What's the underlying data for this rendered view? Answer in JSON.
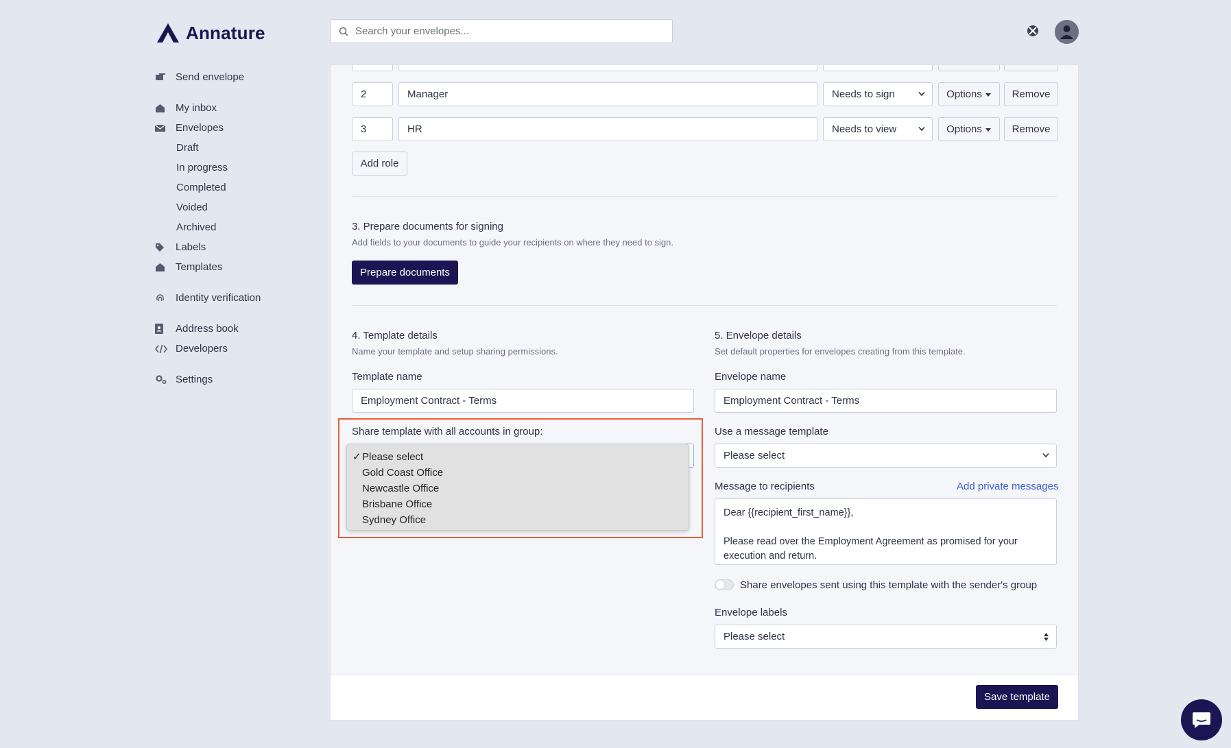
{
  "app": {
    "name": "Annature"
  },
  "search": {
    "placeholder": "Search your envelopes..."
  },
  "sidebar": {
    "send": "Send envelope",
    "inbox": "My inbox",
    "envelopes": "Envelopes",
    "draft": "Draft",
    "in_progress": "In progress",
    "completed": "Completed",
    "voided": "Voided",
    "archived": "Archived",
    "labels": "Labels",
    "templates": "Templates",
    "identity": "Identity verification",
    "address_book": "Address book",
    "developers": "Developers",
    "settings": "Settings"
  },
  "roles": [
    {
      "order": "2",
      "name": "Manager",
      "action": "Needs to sign",
      "options": "Options",
      "remove": "Remove"
    },
    {
      "order": "3",
      "name": "HR",
      "action": "Needs to view",
      "options": "Options",
      "remove": "Remove"
    }
  ],
  "add_role": "Add role",
  "section3": {
    "title": "3. Prepare documents for signing",
    "help": "Add fields to your documents to guide your recipients on where they need to sign.",
    "button": "Prepare documents"
  },
  "section4": {
    "title": "4. Template details",
    "help": "Name your template and setup sharing permissions.",
    "name_label": "Template name",
    "name_value": "Employment Contract - Terms",
    "share_label": "Share template with all accounts in group:",
    "share_options": [
      "Please select",
      "Gold Coast Office",
      "Newcastle Office",
      "Brisbane Office",
      "Sydney Office"
    ],
    "share_check": "✓"
  },
  "section5": {
    "title": "5. Envelope details",
    "help": "Set default properties for envelopes creating from this template.",
    "name_label": "Envelope name",
    "name_value": "Employment Contract - Terms",
    "msg_template_label": "Use a message template",
    "msg_template_value": "Please select",
    "message_label": "Message to recipients",
    "add_private": "Add private messages",
    "message_line1": "Dear {{recipient_first_name}},",
    "message_line2": "Please read over the Employment Agreement as promised for your",
    "message_line3": "execution and return.",
    "share_toggle_label": "Share envelopes sent using this template with the sender's group",
    "labels_label": "Envelope labels",
    "labels_value": "Please select"
  },
  "save_button": "Save template",
  "colors": {
    "brand": "#1b1553",
    "highlight": "#e5603b",
    "link": "#3b5bd6"
  }
}
